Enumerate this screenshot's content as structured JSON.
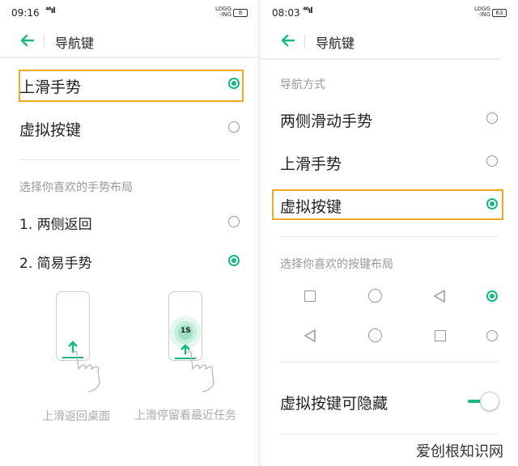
{
  "left": {
    "status": {
      "time": "09:16",
      "signal": "⁴⁶ıl",
      "net": "LOGG\n-ING",
      "battery": "8"
    },
    "header": {
      "title": "导航键"
    },
    "options": [
      {
        "label": "上滑手势",
        "selected": true
      },
      {
        "label": "虚拟按键",
        "selected": false
      }
    ],
    "gesture_section": {
      "title": "选择你喜欢的手势布局",
      "items": [
        {
          "label": "1. 两侧返回",
          "selected": false
        },
        {
          "label": "2. 简易手势",
          "selected": true
        }
      ]
    },
    "illustrations": [
      {
        "caption": "上滑返回桌面"
      },
      {
        "caption": "上滑停留看最近任务",
        "badge": "1S"
      }
    ]
  },
  "right": {
    "status": {
      "time": "08:03",
      "signal": "⁴⁶ıl",
      "net": "LOGG\n-ING",
      "battery": "63"
    },
    "header": {
      "title": "导航键"
    },
    "nav_mode": {
      "title": "导航方式",
      "options": [
        {
          "label": "两侧滑动手势",
          "selected": false
        },
        {
          "label": "上滑手势",
          "selected": false
        },
        {
          "label": "虚拟按键",
          "selected": true
        }
      ]
    },
    "key_layout": {
      "title": "选择你喜欢的按键布局",
      "rows": [
        {
          "icons": [
            "square-icon",
            "circle-icon",
            "triangle-back-icon"
          ],
          "selected": true
        },
        {
          "icons": [
            "triangle-back-icon",
            "circle-icon",
            "square-icon"
          ],
          "selected": false
        }
      ]
    },
    "hideable": {
      "label": "虚拟按键可隐藏",
      "enabled": true
    }
  },
  "watermark": "爱创根知识网",
  "colors": {
    "accent": "#18b87f",
    "highlight": "#f5a623"
  }
}
